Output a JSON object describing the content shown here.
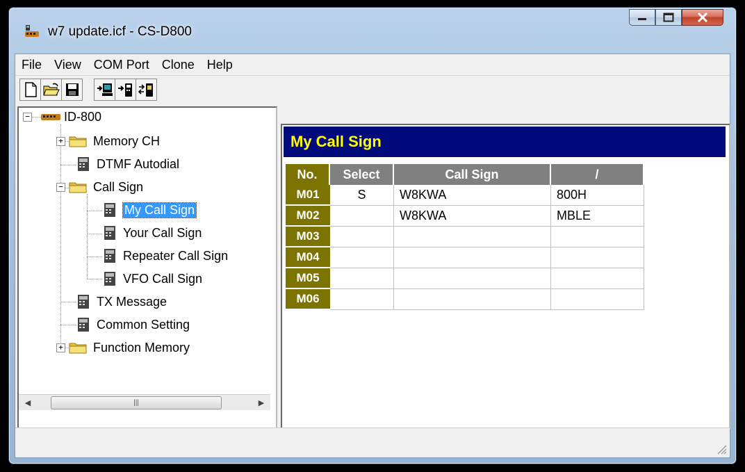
{
  "window": {
    "title": "w7 update.icf - CS-D800"
  },
  "menu": [
    "File",
    "View",
    "COM Port",
    "Clone",
    "Help"
  ],
  "toolbar": {
    "buttons": [
      "new-icon",
      "open-icon",
      "save-icon",
      "read-from-radio-icon",
      "write-to-radio-icon",
      "clone-transfer-icon"
    ]
  },
  "tree": {
    "root": "ID-800",
    "items": [
      {
        "label": "Memory CH"
      },
      {
        "label": "DTMF Autodial"
      },
      {
        "label": "Call Sign"
      },
      {
        "label": "My Call Sign"
      },
      {
        "label": "Your Call Sign"
      },
      {
        "label": "Repeater Call Sign"
      },
      {
        "label": "VFO Call Sign"
      },
      {
        "label": "TX Message"
      },
      {
        "label": "Common Setting"
      },
      {
        "label": "Function Memory"
      }
    ]
  },
  "panel": {
    "title": "My Call Sign",
    "columns": [
      "No.",
      "Select",
      "Call Sign",
      "/"
    ],
    "rows": [
      {
        "no": "M01",
        "select": "S",
        "call": "W8KWA",
        "suffix": "800H"
      },
      {
        "no": "M02",
        "select": "",
        "call": "W8KWA",
        "suffix": "MBLE"
      },
      {
        "no": "M03",
        "select": "",
        "call": "",
        "suffix": ""
      },
      {
        "no": "M04",
        "select": "",
        "call": "",
        "suffix": ""
      },
      {
        "no": "M05",
        "select": "",
        "call": "",
        "suffix": ""
      },
      {
        "no": "M06",
        "select": "",
        "call": "",
        "suffix": ""
      }
    ]
  },
  "colors": {
    "header_bg": "#000a7a",
    "header_text": "#ffff00",
    "row_label_bg": "#7d7300",
    "selection": "#3399ff"
  }
}
